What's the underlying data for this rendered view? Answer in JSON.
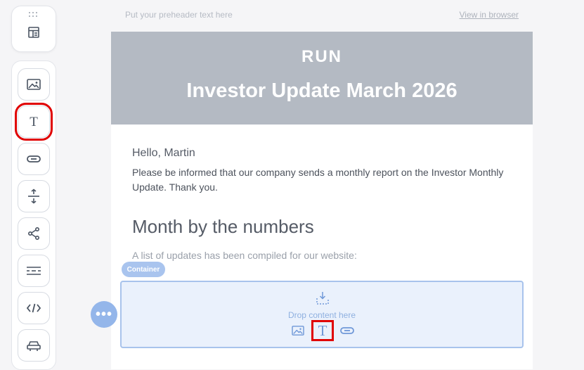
{
  "editor": {
    "preheader_placeholder": "Put your preheader text here",
    "view_in_browser": "View in browser"
  },
  "sidebar": {
    "top": {
      "drag_icon": "drag-handle-icon",
      "blocks_icon": "blocks-icon"
    },
    "tools": [
      {
        "id": "image",
        "icon": "image-icon"
      },
      {
        "id": "text",
        "icon": "text-icon",
        "highlighted": true
      },
      {
        "id": "button",
        "icon": "button-icon"
      },
      {
        "id": "spacer",
        "icon": "spacer-icon"
      },
      {
        "id": "social",
        "icon": "share-icon"
      },
      {
        "id": "divider",
        "icon": "divider-icon"
      },
      {
        "id": "html",
        "icon": "code-icon"
      },
      {
        "id": "menu",
        "icon": "menu-icon"
      }
    ]
  },
  "email": {
    "logo": "RUN",
    "title": "Investor Update March 2026",
    "greeting": "Hello, Martin",
    "intro": "Please be informed that our company sends a monthly report on the Investor Monthly Update. Thank you.",
    "section_title": "Month by the numbers",
    "section_text": "A list of updates has been compiled for our website:"
  },
  "container": {
    "badge": "Container",
    "drop_text": "Drop content here",
    "quick_tools": [
      {
        "id": "image",
        "icon": "image-icon"
      },
      {
        "id": "text",
        "icon": "text-icon",
        "highlighted": true
      },
      {
        "id": "button",
        "icon": "button-icon"
      }
    ]
  },
  "colors": {
    "accent": "#94b6ea",
    "hero_bg": "#b4bac3",
    "highlight": "#e00000",
    "icon": "#4a5462"
  }
}
